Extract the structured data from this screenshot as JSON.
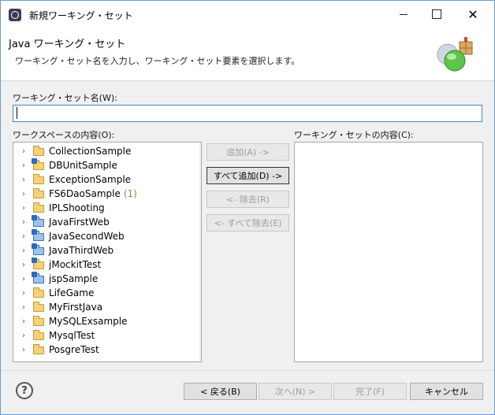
{
  "window": {
    "title": "新規ワーキング・セット",
    "close_glyph": "✕"
  },
  "banner": {
    "title": "Java ワーキング・セット",
    "description": "ワーキング・セット名を入力し、ワーキング・セット要素を選択します。",
    "graphic_icon": "working-set-wizard-graphic"
  },
  "form": {
    "name_label": "ワーキング・セット名(W):",
    "name_value": "",
    "workspace_label": "ワークスペースの内容(O):",
    "content_label": "ワーキング・セットの内容(C):"
  },
  "workspace_projects": [
    {
      "name": "CollectionSample",
      "icon": "project-folder-icon",
      "count": ""
    },
    {
      "name": "DBUnitSample",
      "icon": "java-project-icon",
      "count": ""
    },
    {
      "name": "ExceptionSample",
      "icon": "project-folder-icon",
      "count": ""
    },
    {
      "name": "FS6DaoSample",
      "icon": "project-folder-icon",
      "count": "(1)"
    },
    {
      "name": "IPLShooting",
      "icon": "project-folder-icon",
      "count": ""
    },
    {
      "name": "JavaFirstWeb",
      "icon": "web-project-icon",
      "count": ""
    },
    {
      "name": "JavaSecondWeb",
      "icon": "web-project-icon",
      "count": ""
    },
    {
      "name": "JavaThirdWeb",
      "icon": "web-project-icon",
      "count": ""
    },
    {
      "name": "jMockitTest",
      "icon": "java-project-icon",
      "count": ""
    },
    {
      "name": "jspSample",
      "icon": "web-project-icon",
      "count": ""
    },
    {
      "name": "LifeGame",
      "icon": "project-folder-icon",
      "count": ""
    },
    {
      "name": "MyFirstJava",
      "icon": "project-folder-icon",
      "count": ""
    },
    {
      "name": "MySQLExsample",
      "icon": "project-folder-icon",
      "count": ""
    },
    {
      "name": "MysqlTest",
      "icon": "project-folder-icon",
      "count": ""
    },
    {
      "name": "PosgreTest",
      "icon": "project-folder-icon",
      "count": ""
    }
  ],
  "middle_buttons": {
    "add": "追加(A) ->",
    "add_all": "すべて追加(D) ->",
    "remove": "<- 除去(R)",
    "remove_all": "<- すべて除去(E)"
  },
  "footer": {
    "help": "?",
    "back": "< 戻る(B)",
    "next": "次へ(N) >",
    "finish": "完了(F)",
    "cancel": "キャンセル"
  },
  "colors": {
    "focus_border": "#3b8bd6",
    "count_color": "#b07d3a"
  }
}
